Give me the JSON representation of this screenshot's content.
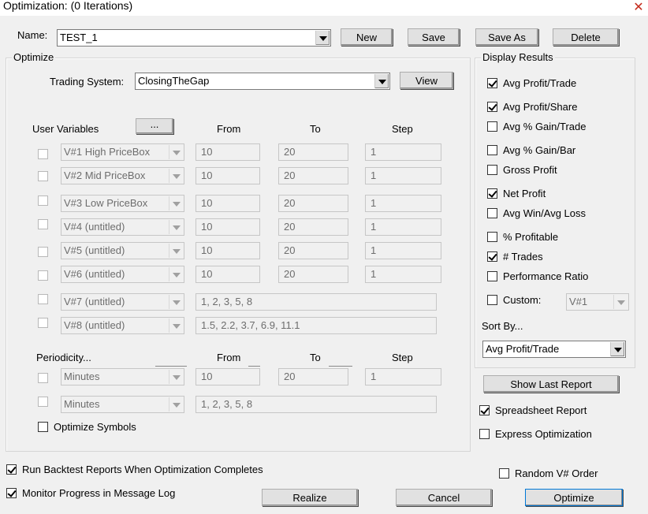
{
  "window": {
    "title": "Optimization:  (0 Iterations)",
    "close_glyph": "✕"
  },
  "name_row": {
    "label": "Name:",
    "value": "TEST_1",
    "buttons": [
      "New",
      "Save",
      "Save As",
      "Delete"
    ]
  },
  "optimize": {
    "group_title": "Optimize",
    "trading_system_label": "Trading System:",
    "trading_system_value": "ClosingTheGap",
    "view_button": "View",
    "user_variables_label": "User Variables",
    "ellipsis_button": "...",
    "headers": {
      "from": "From",
      "to": "To",
      "step": "Step"
    },
    "variables": [
      {
        "name": "V#1  High PriceBox",
        "from": "10",
        "to": "20",
        "step": "1",
        "checked": false
      },
      {
        "name": "V#2  Mid PriceBox",
        "from": "10",
        "to": "20",
        "step": "1",
        "checked": false
      },
      {
        "name": "V#3  Low PriceBox",
        "from": "10",
        "to": "20",
        "step": "1",
        "checked": false
      },
      {
        "name": "V#4 (untitled)",
        "from": "10",
        "to": "20",
        "step": "1",
        "checked": false
      },
      {
        "name": "V#5 (untitled)",
        "from": "10",
        "to": "20",
        "step": "1",
        "checked": false
      },
      {
        "name": "V#6 (untitled)",
        "from": "10",
        "to": "20",
        "step": "1",
        "checked": false
      },
      {
        "name": "V#7 (untitled)",
        "list": "1, 2, 3, 5, 8",
        "checked": false
      },
      {
        "name": "V#8 (untitled)",
        "list": "1.5, 2.2, 3.7, 6.9, 11.1",
        "checked": false
      }
    ],
    "periodicity_label": "Periodicity...",
    "periodicity_rows": [
      {
        "unit": "Minutes",
        "from": "10",
        "to": "20",
        "step": "1",
        "checked": false
      },
      {
        "unit": "Minutes",
        "list": "1, 2, 3, 5, 8",
        "checked": false
      }
    ],
    "optimize_symbols_label": "Optimize Symbols"
  },
  "display_results": {
    "group_title": "Display Results",
    "items": [
      {
        "label": "Avg Profit/Trade",
        "checked": true
      },
      {
        "label": "Avg Profit/Share",
        "checked": true
      },
      {
        "label": "Avg % Gain/Trade",
        "checked": false
      },
      {
        "label": "Avg % Gain/Bar",
        "checked": false
      },
      {
        "label": "Gross Profit",
        "checked": false
      },
      {
        "label": "Net Profit",
        "checked": true
      },
      {
        "label": "Avg Win/Avg Loss",
        "checked": false
      },
      {
        "label": "% Profitable",
        "checked": false
      },
      {
        "label": "# Trades",
        "checked": true
      },
      {
        "label": "Performance Ratio",
        "checked": false
      }
    ],
    "custom_label": "Custom:",
    "custom_value": "V#1",
    "sort_by_label": "Sort By...",
    "sort_by_value": "Avg Profit/Trade"
  },
  "show_last_report_button": "Show Last Report",
  "spreadsheet_report": {
    "label": "Spreadsheet Report",
    "checked": true
  },
  "express_optimization": {
    "label": "Express Optimization",
    "checked": false
  },
  "random_order": {
    "label": "Random V# Order",
    "checked": false
  },
  "run_backtest": {
    "label": "Run Backtest Reports When Optimization Completes",
    "checked": true
  },
  "monitor_progress": {
    "label": "Monitor Progress in Message Log",
    "checked": true
  },
  "bottom_buttons": {
    "realize": "Realize",
    "cancel": "Cancel",
    "optimize": "Optimize"
  }
}
